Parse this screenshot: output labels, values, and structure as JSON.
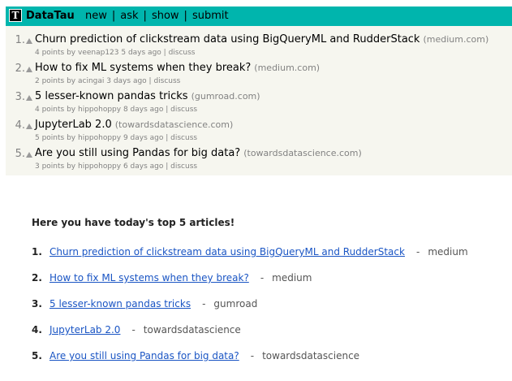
{
  "header": {
    "logo_letter": "T",
    "site_name": "DataTau",
    "nav": [
      "new",
      "ask",
      "show",
      "submit"
    ],
    "separator": "|",
    "brand_color": "#00b5ad"
  },
  "items": [
    {
      "rank": "1.",
      "title": "Churn prediction of clickstream data using BigQueryML and RudderStack",
      "domain": "(medium.com)",
      "meta": "4 points by veenap123 5 days ago",
      "discuss": "discuss"
    },
    {
      "rank": "2.",
      "title": "How to fix ML systems when they break?",
      "domain": "(medium.com)",
      "meta": "2 points by acingai 3 days ago",
      "discuss": "discuss"
    },
    {
      "rank": "3.",
      "title": "5 lesser-known pandas tricks",
      "domain": "(gumroad.com)",
      "meta": "4 points by hippohoppy 8 days ago",
      "discuss": "discuss"
    },
    {
      "rank": "4.",
      "title": "JupyterLab 2.0",
      "domain": "(towardsdatascience.com)",
      "meta": "5 points by hippohoppy 9 days ago",
      "discuss": "discuss"
    },
    {
      "rank": "5.",
      "title": "Are you still using Pandas for big data?",
      "domain": "(towardsdatascience.com)",
      "meta": "3 points by hippohoppy 6 days ago",
      "discuss": "discuss"
    }
  ],
  "summary": {
    "heading": "Here you have today's top 5 articles!",
    "articles": [
      {
        "num": "1.",
        "title": "Churn prediction of clickstream data using BigQueryML and RudderStack",
        "dash": "-",
        "source": "medium"
      },
      {
        "num": "2.",
        "title": "How to fix ML systems when they break?",
        "dash": "-",
        "source": "medium"
      },
      {
        "num": "3.",
        "title": "5 lesser-known pandas tricks",
        "dash": "-",
        "source": "gumroad"
      },
      {
        "num": "4.",
        "title": "JupyterLab 2.0",
        "dash": "-",
        "source": "towardsdatascience"
      },
      {
        "num": "5.",
        "title": "Are you still using Pandas for big data?",
        "dash": "-",
        "source": "towardsdatascience"
      }
    ]
  }
}
